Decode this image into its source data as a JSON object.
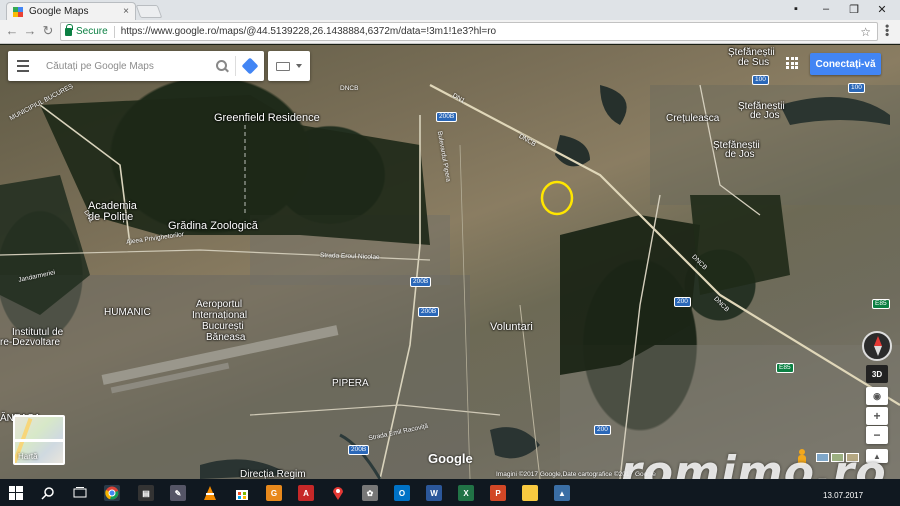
{
  "browser": {
    "tab_title": "Google Maps",
    "tab_close": "×",
    "secure_label": "Secure",
    "url": "https://www.google.ro/maps/@44.5139228,26.1438884,6372m/data=!3m1!1e3?hl=ro",
    "window_controls": {
      "minimize": "–",
      "maximize": "❐",
      "close": "✕"
    },
    "nav": {
      "back": "←",
      "forward": "→",
      "reload": "↻"
    },
    "star": "☆",
    "menu": "⋮"
  },
  "maps": {
    "search_placeholder": "Căutați pe Google Maps",
    "signin_label": "Conectați-vă",
    "minimap_label": "Hartă",
    "view_3d": "3D",
    "zoom_in": "+",
    "zoom_out": "−",
    "locate": "◉",
    "collapse": "▲",
    "logo": "Google",
    "credits": "Imagini ©2017 Google,Date cartografice ©2017 Google",
    "watermark": "romimo.ro",
    "places": {
      "stefanesti_sus_1": "Ștefăneștii",
      "stefanesti_sus_2": "de Sus",
      "stefanesti_jos_1": "Ștefăneștii",
      "stefanesti_jos_2": "de Jos",
      "stefanesti_jos_b1": "Ștefăneștii",
      "stefanesti_jos_b2": "de Jos",
      "cretuleasca": "Crețuleasca",
      "greenfield": "Greenfield Residence",
      "academia_1": "Academia",
      "academia_2": "de Poliție",
      "gradina": "Grădina Zoologică",
      "humanic": "HUMANIC",
      "aeroport_1": "Aeroportul",
      "aeroport_2": "Internațional",
      "aeroport_3": "București",
      "aeroport_4": "Băneasa",
      "institutul_1": "Institutul de",
      "institutul_2": "re-Dezvoltare",
      "voluntari": "Voluntari",
      "pipera": "PIPERA",
      "baneasa": "ĂNEASA",
      "directia": "Direcția Regim",
      "municipiul": "MUNICIPIUL BUCUREȘ"
    },
    "roads": {
      "dn1": "DN1",
      "dncb_1": "DNCB",
      "dncb_2": "DNCB",
      "dncb_3": "DNCB",
      "dncb_4": "DNCB",
      "aleea": "Aleea Privighetorilor",
      "strada_erou": "Strada Eroul Nicolae",
      "strada_emil": "Strada Emil Racoviță",
      "jandarmeriei": "Jandarmeriei",
      "bulevardul": "Bulevardul Pipera",
      "dn1_bottom": "DN1"
    },
    "shields": {
      "s200b_a": "200B",
      "s200b_b": "200B",
      "s200b_c": "200B",
      "s200b_d": "200B",
      "s200_a": "200",
      "s200_b": "200",
      "s100_a": "100",
      "s100_b": "100",
      "e85": "E85",
      "e85b": "E85"
    },
    "marker_color": "#ffe600"
  },
  "taskbar": {
    "date": "13.07.2017",
    "apps": [
      "start",
      "search",
      "task-view",
      "chrome",
      "media",
      "tools",
      "vlc",
      "store",
      "gallery",
      "acrobat",
      "maps-pin",
      "paint",
      "outlook",
      "word",
      "excel",
      "powerpoint",
      "explorer",
      "photos"
    ]
  }
}
